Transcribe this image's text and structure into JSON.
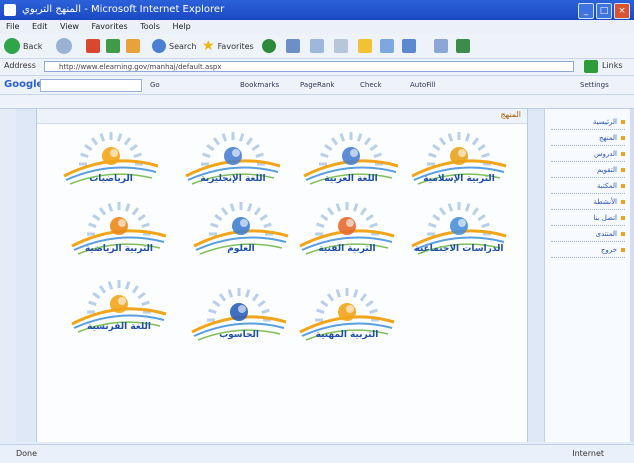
{
  "window": {
    "title": "المنهج التربوي - Microsoft Internet Explorer",
    "controls": [
      "_",
      "□",
      "×"
    ]
  },
  "menu": [
    "File",
    "Edit",
    "View",
    "Favorites",
    "Tools",
    "Help"
  ],
  "toolbar": {
    "back_label": "Back",
    "search_label": "Search",
    "favorites_label": "Favorites"
  },
  "address": {
    "label": "Address",
    "value": "http://www.elearning.gov/manhaj/default.aspx",
    "go_label": "Go",
    "links_label": "Links"
  },
  "google": {
    "logo": "Google",
    "items": [
      "Go",
      "Bookmarks",
      "PageRank",
      "Check",
      "AutoFill",
      "Settings"
    ]
  },
  "frame": {
    "title": "المنهج"
  },
  "sidebar": {
    "items": [
      "الرئيسية",
      "المنهج",
      "الدروس",
      "التقويم",
      "المكتبة",
      "الأنشطة",
      "اتصل بنا",
      "المنتدى",
      "خروج"
    ]
  },
  "tiles": [
    {
      "label": "الرياضيات",
      "icon": "sun-icon"
    },
    {
      "label": "اللغة الإنجليزية",
      "icon": "book-icon"
    },
    {
      "label": "اللغة العربية",
      "icon": "book-icon"
    },
    {
      "label": "التربية الإسلامية",
      "icon": "crescent-icon"
    },
    {
      "label": "التربية الرياضية",
      "icon": "ball-icon"
    },
    {
      "label": "العلوم",
      "icon": "flask-icon"
    },
    {
      "label": "التربية الفنية",
      "icon": "palette-icon"
    },
    {
      "label": "الدراسات الاجتماعية",
      "icon": "globe-icon"
    },
    {
      "label": "اللغة الفرنسية",
      "icon": "sun-icon"
    },
    {
      "label": "الحاسوب",
      "icon": "mouse-icon"
    },
    {
      "label": "التربية المهنية",
      "icon": "sun-icon"
    }
  ],
  "status": {
    "text": "Done",
    "zone": "Internet"
  },
  "colors": {
    "title_bar": "#1a49c2",
    "label": "#1f4fa8",
    "sun": "#f2a51a"
  }
}
